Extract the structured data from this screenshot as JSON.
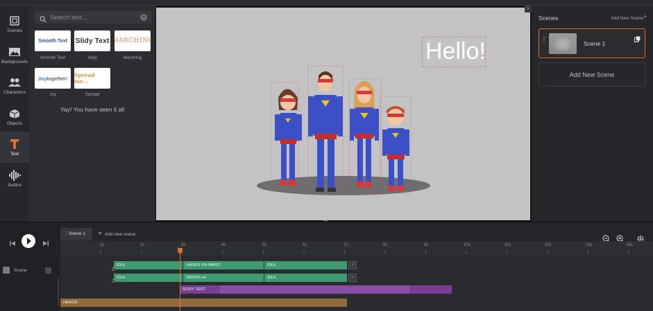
{
  "sidebar": {
    "items": [
      {
        "label": "Scenes",
        "icon": "scenes-icon"
      },
      {
        "label": "Backgrounds",
        "icon": "image-icon"
      },
      {
        "label": "Characters",
        "icon": "people-icon"
      },
      {
        "label": "Objects",
        "icon": "cube-icon"
      },
      {
        "label": "Text",
        "icon": "text-icon",
        "active": true
      },
      {
        "label": "Audios",
        "icon": "waveform-icon"
      }
    ],
    "accent_color": "#e0702a"
  },
  "text_panel": {
    "search_placeholder": "Search text...",
    "presets": [
      {
        "preview": "Smooth Text",
        "label": "Smooth Text"
      },
      {
        "preview": "Slidy Text",
        "label": "Slidy"
      },
      {
        "preview": "MARCHING",
        "label": "Marching"
      },
      {
        "preview_a": "Joy",
        "preview_b": "together!",
        "label": "Joy"
      },
      {
        "preview": "Spread me...",
        "label": "Spread"
      }
    ],
    "end_message": "Yay! You have seen it all"
  },
  "stage": {
    "headline": "Hello!",
    "background_color": "#c3c3c3"
  },
  "scenes_panel": {
    "title": "Scenes",
    "add_link": "Add New Scene",
    "scenes": [
      {
        "name": "Scene 1",
        "selected": true
      }
    ],
    "add_button": "Add New Scene"
  },
  "timeline": {
    "tabs": [
      {
        "label": "Scene 1"
      }
    ],
    "add_scene_label": "Add new scene",
    "row_label": "Scene",
    "ruler_labels": [
      "1s",
      "2s",
      "3s",
      "4s",
      "5s",
      "6s",
      "7s",
      "8s",
      "9s",
      "10s",
      "11s",
      "12s",
      "13s",
      "14s"
    ],
    "tracks": [
      {
        "clips": [
          "IDLE",
          "HANDS ON WAIST",
          "IDLE"
        ]
      },
      {
        "clips": [
          "IDLE",
          "SAYING HI",
          "IDLE"
        ]
      },
      {
        "clips": [
          "SLIDY TEXT"
        ]
      },
      {
        "clips": [
          "HEROS"
        ]
      }
    ]
  }
}
